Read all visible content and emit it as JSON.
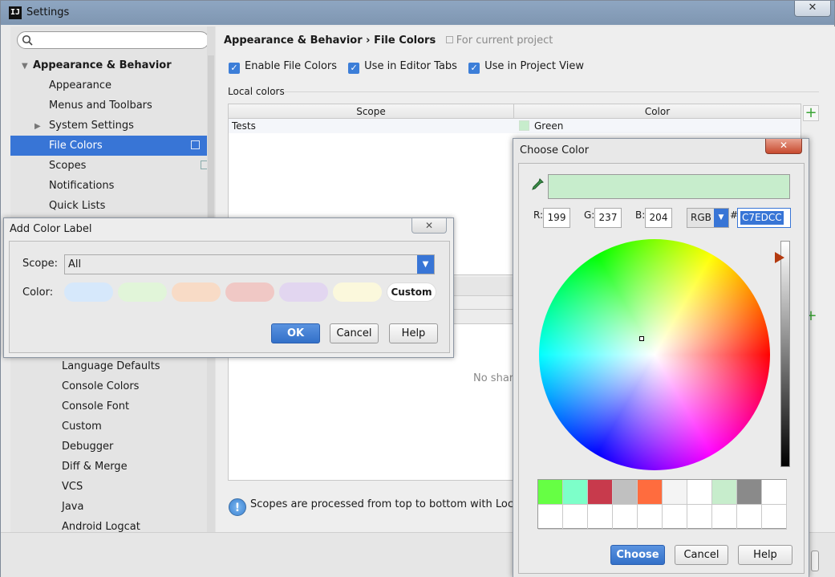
{
  "window": {
    "title": "Settings",
    "close_glyph": "✕"
  },
  "sidebar": {
    "search_placeholder": "",
    "root": "Appearance & Behavior",
    "items": [
      {
        "label": "Appearance"
      },
      {
        "label": "Menus and Toolbars"
      },
      {
        "label": "System Settings"
      },
      {
        "label": "File Colors"
      },
      {
        "label": "Scopes"
      },
      {
        "label": "Notifications"
      },
      {
        "label": "Quick Lists"
      }
    ],
    "editor_items": [
      {
        "label": "Language Defaults"
      },
      {
        "label": "Console Colors"
      },
      {
        "label": "Console Font"
      },
      {
        "label": "Custom"
      },
      {
        "label": "Debugger"
      },
      {
        "label": "Diff & Merge"
      },
      {
        "label": "VCS"
      },
      {
        "label": "Java"
      },
      {
        "label": "Android Logcat"
      }
    ]
  },
  "main": {
    "breadcrumb_parent": "Appearance & Behavior",
    "breadcrumb_sep": "›",
    "breadcrumb_current": "File Colors",
    "breadcrumb_hint": "For current project",
    "checkboxes": [
      {
        "label": "Enable File Colors",
        "checked": true
      },
      {
        "label": "Use in Editor Tabs",
        "checked": true
      },
      {
        "label": "Use in Project View",
        "checked": true
      }
    ],
    "local_colors_label": "Local colors",
    "table": {
      "headers": [
        "Scope",
        "Color"
      ],
      "rows": [
        {
          "scope": "Tests",
          "color": "Green",
          "swatch": "#c7edcc"
        }
      ]
    },
    "no_shared_text": "No share",
    "info_text": "Scopes are processed from top to bottom with Local co"
  },
  "add_color_dialog": {
    "title": "Add Color Label",
    "close_glyph": "✕",
    "scope_label": "Scope:",
    "scope_value": "All",
    "color_label": "Color:",
    "swatches": [
      "#d6e8fb",
      "#e1f5d9",
      "#f8dbc6",
      "#f0c8c5",
      "#e2d6f0",
      "#fbf8dc"
    ],
    "custom_label": "Custom",
    "ok_label": "OK",
    "cancel_label": "Cancel",
    "help_label": "Help"
  },
  "choose_color_dialog": {
    "title": "Choose Color",
    "close_glyph": "✕",
    "preview_color": "#c7edcc",
    "r_label": "R:",
    "r_value": "199",
    "g_label": "G:",
    "g_value": "237",
    "b_label": "B:",
    "b_value": "204",
    "mode": "RGB",
    "hash": "#",
    "hex_value": "C7EDCC",
    "recent_colors": [
      "#66ff44",
      "#7dffc9",
      "#c83a4c",
      "#c0c0c0",
      "#ff6c3e",
      "#f4f4f4",
      "#ffffff",
      "#c7edcc",
      "#8a8a8a",
      "#ffffff"
    ],
    "choose_label": "Choose",
    "cancel_label": "Cancel",
    "help_label": "Help"
  }
}
